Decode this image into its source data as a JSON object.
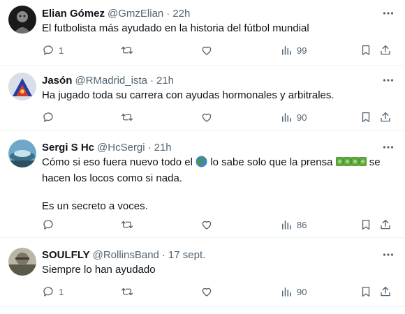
{
  "tweets": [
    {
      "name": "Elian Gómez",
      "handle": "@GmzElian",
      "dot": "·",
      "time": "22h",
      "text_lines": [
        "El futbolista más ayudado en la historia del fútbol mundial"
      ],
      "replies": "1",
      "views": "99"
    },
    {
      "name": "Jasón",
      "handle": "@RMadrid_ista",
      "dot": "·",
      "time": "21h",
      "text_lines": [
        "Ha jugado toda su carrera con ayudas hormonales y arbitrales."
      ],
      "replies": "",
      "views": "90"
    },
    {
      "name": "Sergi S Hc",
      "handle": "@HcSergi",
      "dot": "·",
      "time": "21h",
      "text_line1_a": "Cómo si eso fuera nuevo todo el",
      "text_line1_b": "lo sabe solo que la prensa",
      "text_line1_c": "se",
      "text_line2": "hacen los locos como si nada.",
      "text_line3": "Es un secreto a voces.",
      "emoji_globe": "globe-americas-emoji",
      "emoji_money": "dollar-banknotes-emoji",
      "replies": "",
      "views": "86"
    },
    {
      "name": "SOULFLY",
      "handle": "@RollinsBand",
      "dot": "·",
      "time": "17 sept.",
      "text_lines": [
        "Siempre lo han ayudado"
      ],
      "replies": "1",
      "views": "90"
    }
  ],
  "icons": {
    "more": "more-horizontal-icon",
    "reply": "reply-bubble-icon",
    "retweet": "retweet-icon",
    "like": "heart-icon",
    "views": "views-bar-chart-icon",
    "bookmark": "bookmark-icon",
    "share": "share-upload-icon"
  },
  "colors": {
    "text": "#0f1419",
    "secondary": "#536471",
    "divider": "#eff3f4"
  }
}
